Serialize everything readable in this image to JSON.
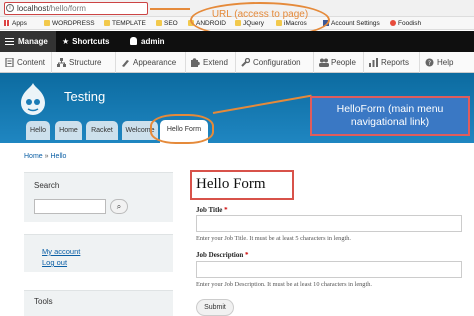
{
  "browser": {
    "url_host": "localhost",
    "url_path": "/hello/form",
    "bookmarks": [
      "Apps",
      "WORDPRESS",
      "TEMPLATE",
      "SEO",
      "ANDROID",
      "JQuery",
      "iMacros",
      "Account Settings",
      "Foodish"
    ]
  },
  "toolbar": {
    "manage": "Manage",
    "shortcuts": "Shortcuts",
    "user": "admin"
  },
  "menu": [
    "Content",
    "Structure",
    "Appearance",
    "Extend",
    "Configuration",
    "People",
    "Reports",
    "Help"
  ],
  "site": {
    "name": "Testing",
    "tabs": [
      "Hello",
      "Home",
      "Racket",
      "Welcome",
      "Hello Form"
    ],
    "active_tab": "Hello Form"
  },
  "breadcrumb": [
    "Home",
    "»",
    "Hello"
  ],
  "sidebar": {
    "search_title": "Search",
    "search_button": "⌕",
    "account_links": [
      "My account",
      "Log out"
    ],
    "tools_title": "Tools"
  },
  "page": {
    "title": "Hello Form",
    "fields": [
      {
        "label": "Job Title",
        "required": "*",
        "hint": "Enter your Job Title. It must be at least 5 characters in length."
      },
      {
        "label": "Job Description",
        "required": "*",
        "hint": "Enter your Job Description. It must be at least 10 characters in length."
      }
    ],
    "submit": "Submit"
  },
  "annotations": {
    "url_note": "URL (access to page)",
    "menu_note": "HelloForm (main menu navigational link)"
  },
  "colors": {
    "header": "#1a7bb6",
    "annotation": "#e58a3a",
    "note_box": "#3a78c4"
  }
}
